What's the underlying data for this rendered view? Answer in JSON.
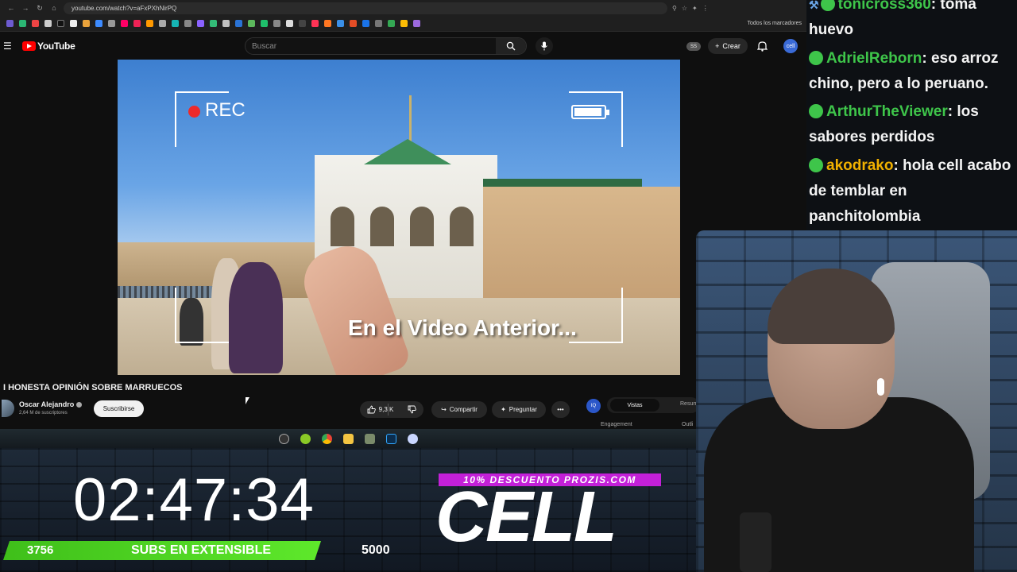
{
  "browser": {
    "url": "youtube.com/watch?v=aFxPXhNirPQ",
    "bookmarks_all": "Todos los marcadores"
  },
  "youtube": {
    "logo_text": "YouTube",
    "search": {
      "placeholder": "Buscar"
    },
    "ss_badge": "SS",
    "create_label": "Crear",
    "avatar_initials": "cell"
  },
  "video": {
    "overlay_rec": "REC",
    "subtitle": "En el Video Anterior...",
    "title": "I HONESTA OPINIÓN SOBRE MARRUECOS",
    "channel": {
      "name": "Oscar Alejandro",
      "subscribers": "2,64 M de suscriptores",
      "subscribe_label": "Suscribirse"
    },
    "likes": "9,3 K",
    "share_label": "Compartir",
    "ask_label": "Preguntar"
  },
  "side_panel": {
    "icon_label": "IQ",
    "tabs": [
      "Vistas",
      "Resum"
    ],
    "sub_labels": [
      "Engagement",
      "Outli"
    ]
  },
  "stream": {
    "timer": "02:47:34",
    "subs_current": "3756",
    "subs_label": "SUBS EN EXTENSIBLE",
    "subs_goal": "5000",
    "promo": "10% DESCUENTO PROZIS.COM",
    "logo": "CELL"
  },
  "chat": {
    "messages": [
      {
        "user": "tonicross360",
        "color": "#3ec54a",
        "text": ": toma huevo"
      },
      {
        "user": "AdrielReborn",
        "color": "#3ec54a",
        "text": ": eso arroz chino, pero a lo peruano."
      },
      {
        "user": "ArthurTheViewer",
        "color": "#3ec54a",
        "text": ": los sabores perdidos"
      },
      {
        "user": "akodrako",
        "color": "#f0b000",
        "text": ": hola cell acabo de temblar en panchitolombia"
      }
    ]
  }
}
